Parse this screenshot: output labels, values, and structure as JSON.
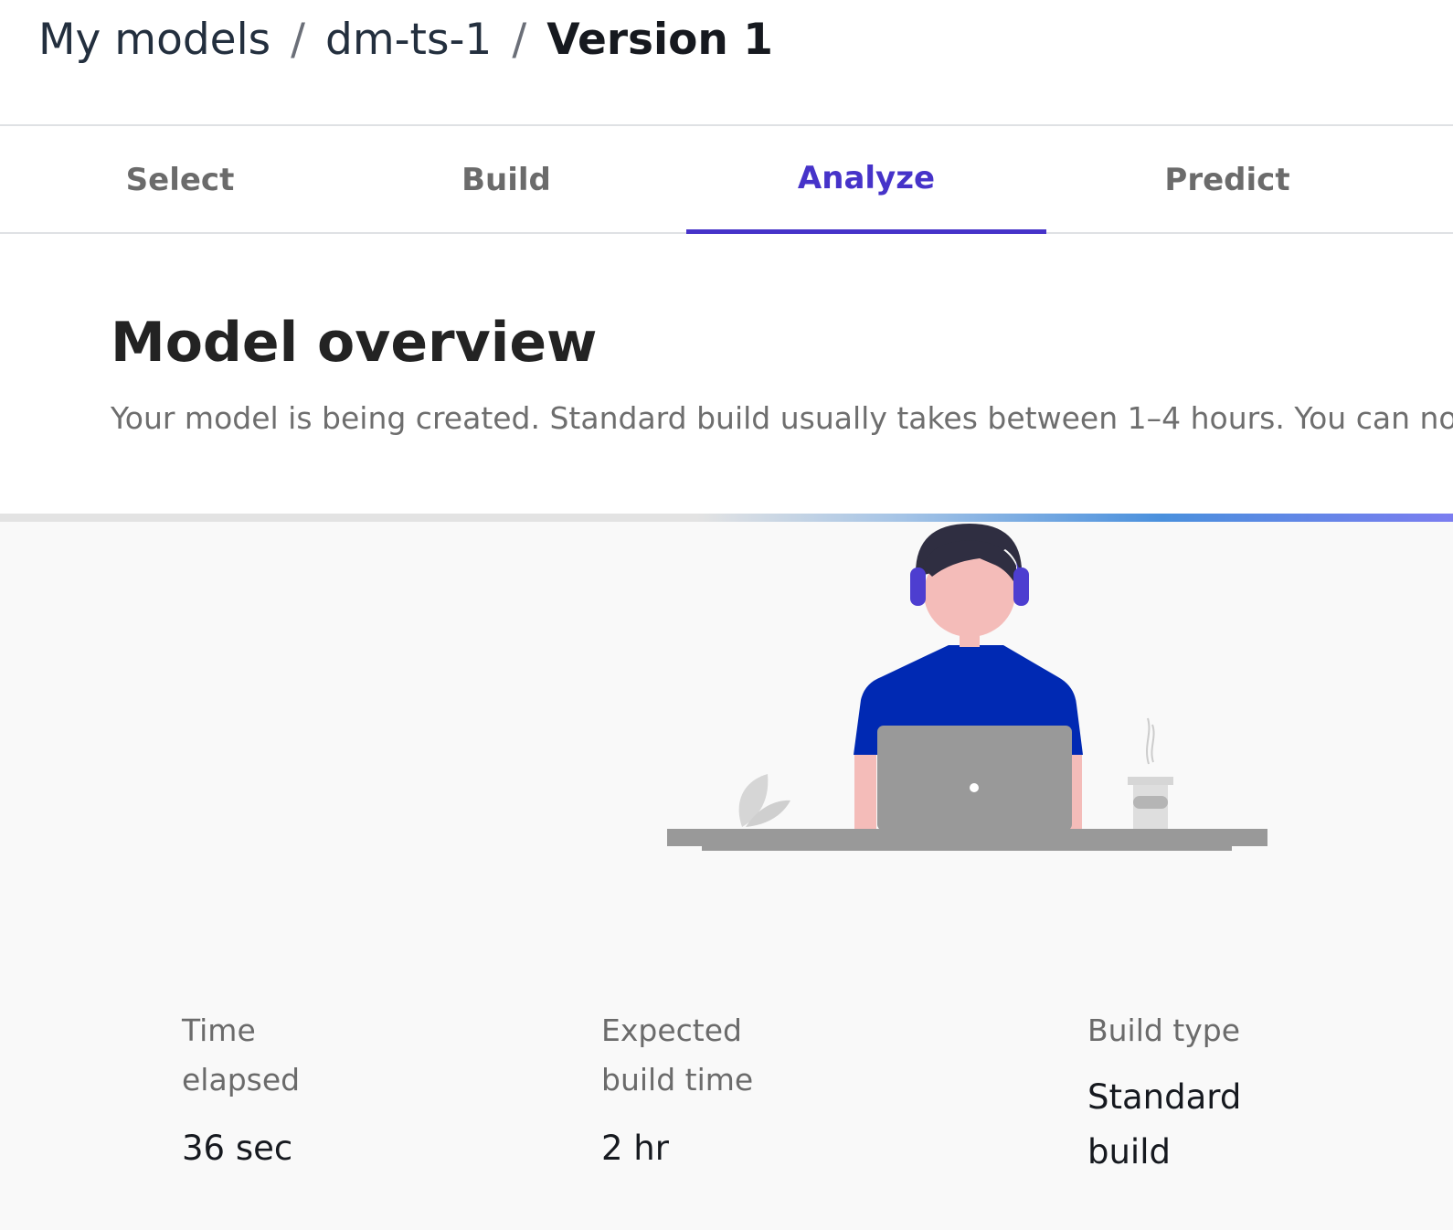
{
  "breadcrumb": {
    "items": [
      "My models",
      "dm-ts-1"
    ],
    "separator": "/",
    "current": "Version 1"
  },
  "tabs": [
    {
      "label": "Select",
      "active": false
    },
    {
      "label": "Build",
      "active": false
    },
    {
      "label": "Analyze",
      "active": true
    },
    {
      "label": "Predict",
      "active": false
    }
  ],
  "overview": {
    "title": "Model overview",
    "description": "Your model is being created. Standard build usually takes between 1–4 hours. You can now leave this page."
  },
  "illustration": {
    "icon": "person-with-laptop-illustration",
    "colors": {
      "shirt": "#0029b3",
      "headphones": "#4d3ed0",
      "hair": "#2f2e41",
      "skin": "#f4bcb9",
      "laptop": "#999999",
      "desk": "#999999"
    }
  },
  "stats": {
    "time_elapsed": {
      "label_line1": "Time",
      "label_line2": "elapsed",
      "value": "36 sec"
    },
    "expected_build_time": {
      "label_line1": "Expected",
      "label_line2": "build time",
      "value": "2 hr"
    },
    "build_type": {
      "label": "Build type",
      "value_line1": "Standard",
      "value_line2": "build"
    }
  },
  "colors": {
    "accent": "#4633c9",
    "progress_gradient_end": "#7b7df0",
    "panel_background": "#f9f9f9"
  }
}
